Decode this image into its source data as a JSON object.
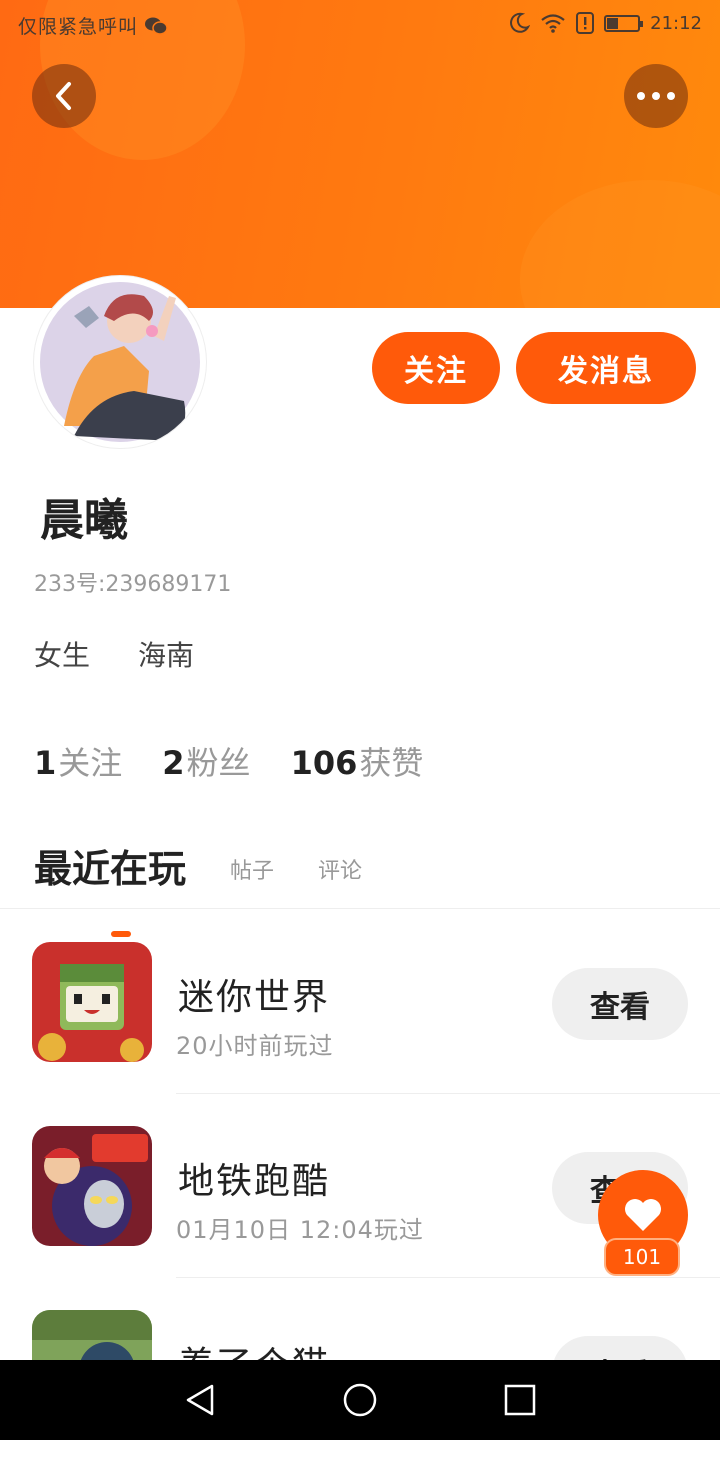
{
  "status_bar": {
    "left_text": "仅限紧急呼叫",
    "time": "21:12",
    "battery_level": 0.35
  },
  "header": {
    "back_icon": "back-chevron-icon",
    "more_icon": "more-dots-icon"
  },
  "profile": {
    "name": "晨曦",
    "id_text": "233号:239689171",
    "gender": "女生",
    "region": "海南",
    "follow_label": "关注",
    "message_label": "发消息",
    "stats": [
      {
        "count": "1",
        "label": "关注"
      },
      {
        "count": "2",
        "label": "粉丝"
      },
      {
        "count": "106",
        "label": "获赞"
      }
    ]
  },
  "tabs": [
    "最近在玩",
    "帖子",
    "评论"
  ],
  "games": [
    {
      "name": "迷你世界",
      "time": "20小时前玩过",
      "button": "查看"
    },
    {
      "name": "地铁跑酷",
      "time": "01月10日  12:04玩过",
      "button": "查看"
    },
    {
      "name": "养了个猫",
      "time": "",
      "button": "查看"
    }
  ],
  "like": {
    "count": "101",
    "icon": "heart-icon"
  },
  "colors": {
    "accent": "#ff5a0a",
    "header": "#ff7a10"
  }
}
